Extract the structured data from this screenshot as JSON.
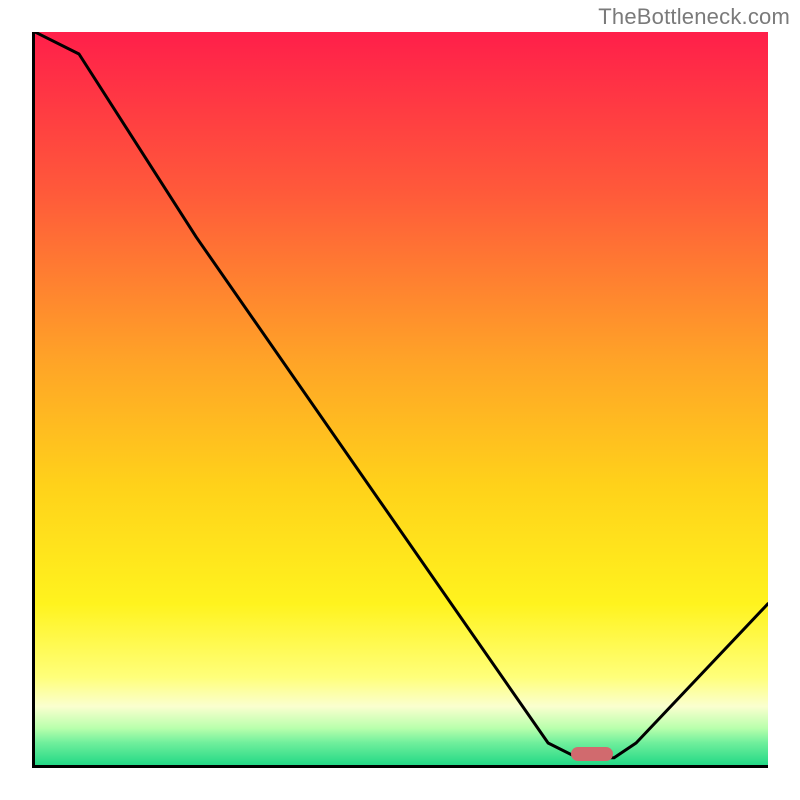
{
  "watermark": "TheBottleneck.com",
  "colors": {
    "axis": "#000000",
    "curve": "#000000",
    "marker": "#d16a6e",
    "watermark_text": "#7a7a7a"
  },
  "chart_data": {
    "type": "line",
    "title": "",
    "xlabel": "",
    "ylabel": "",
    "xlim": [
      0,
      100
    ],
    "ylim": [
      0,
      100
    ],
    "x": [
      0,
      6,
      22,
      70,
      74,
      79,
      82,
      100
    ],
    "values": [
      100,
      97,
      72,
      3,
      1,
      1,
      3,
      22
    ],
    "marker": {
      "x": 76,
      "y": 1.5
    },
    "background_gradient_stops": [
      {
        "pct": 0,
        "color": "#ff1f4a"
      },
      {
        "pct": 22,
        "color": "#ff5a3a"
      },
      {
        "pct": 45,
        "color": "#ffa427"
      },
      {
        "pct": 62,
        "color": "#ffd21a"
      },
      {
        "pct": 78,
        "color": "#fff31e"
      },
      {
        "pct": 88,
        "color": "#ffff7a"
      },
      {
        "pct": 92,
        "color": "#faffcf"
      },
      {
        "pct": 95,
        "color": "#b8ffac"
      },
      {
        "pct": 97,
        "color": "#6fef9c"
      },
      {
        "pct": 100,
        "color": "#23d886"
      }
    ]
  }
}
